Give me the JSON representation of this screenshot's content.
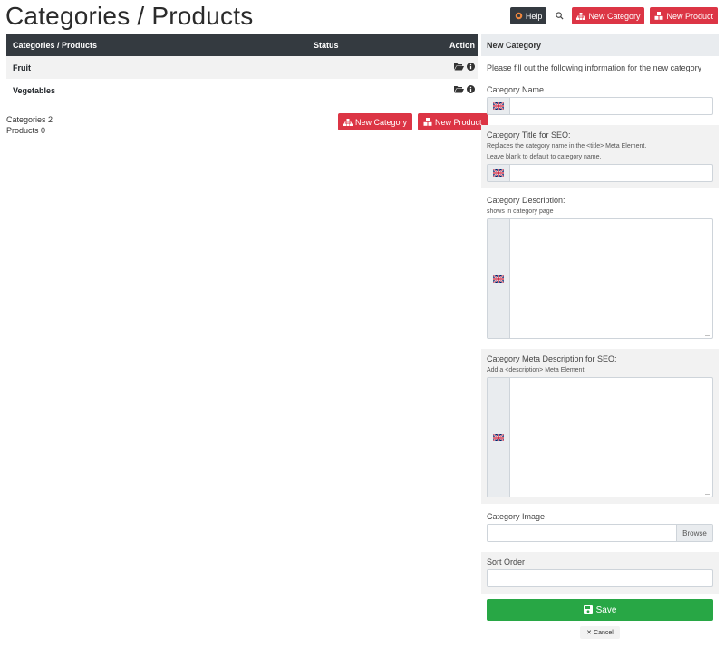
{
  "page": {
    "title": "Categories / Products"
  },
  "toolbar": {
    "help_label": "Help",
    "new_category_label": "New Category",
    "new_product_label": "New Product"
  },
  "table": {
    "columns": {
      "name": "Categories / Products",
      "status": "Status",
      "action": "Action"
    },
    "rows": [
      {
        "name": "Fruit"
      },
      {
        "name": "Vegetables"
      }
    ],
    "counts": {
      "categories": "Categories 2",
      "products": "Products 0"
    },
    "new_category_label": "New Category",
    "new_product_label": "New Product"
  },
  "form": {
    "header": "New Category",
    "intro": "Please fill out the following information for the new category",
    "fields": {
      "name_label": "Category Name",
      "seo_title_label": "Category Title for SEO:",
      "seo_title_hint1": "Replaces the category name in the <title> Meta Element.",
      "seo_title_hint2": "Leave blank to default to category name.",
      "description_label": "Category Description:",
      "description_hint": "shows in category page",
      "meta_desc_label": "Category Meta Description for SEO:",
      "meta_desc_hint": "Add a <description> Meta Element.",
      "image_label": "Category Image",
      "browse_label": "Browse",
      "sort_order_label": "Sort Order"
    },
    "save_label": "Save",
    "cancel_label": "Cancel"
  },
  "colors": {
    "dark": "#343a40",
    "red": "#dc3545",
    "green": "#28a745",
    "light": "#f2f2f2"
  }
}
